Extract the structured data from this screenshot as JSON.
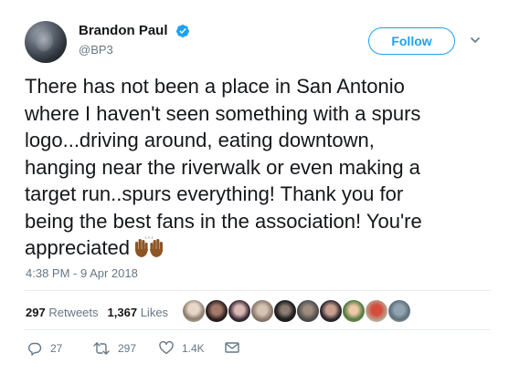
{
  "author": {
    "name": "Brandon Paul",
    "handle": "@BP3"
  },
  "follow_button": {
    "label": "Follow"
  },
  "tweet": {
    "lines": [
      "There has not been a place in San Antonio",
      "where I haven't seen something with a spurs",
      "logo...driving around, eating downtown,",
      "hanging near the riverwalk or even making a",
      "target run..spurs everything! Thank you for",
      "being the best fans in the association! You're",
      "appreciated"
    ],
    "emoji": "raised-hands-icon",
    "timestamp": "4:38 PM - 9 Apr 2018"
  },
  "stats": {
    "retweets_count": "297",
    "retweets_label": "Retweets",
    "likes_count": "1,367",
    "likes_label": "Likes"
  },
  "actions": {
    "replies": "27",
    "retweets": "297",
    "likes": "1.4K"
  },
  "colors": {
    "brand_blue": "#1da1f2",
    "muted": "#657786",
    "text": "#14171a",
    "divider": "#e6ecf0"
  }
}
